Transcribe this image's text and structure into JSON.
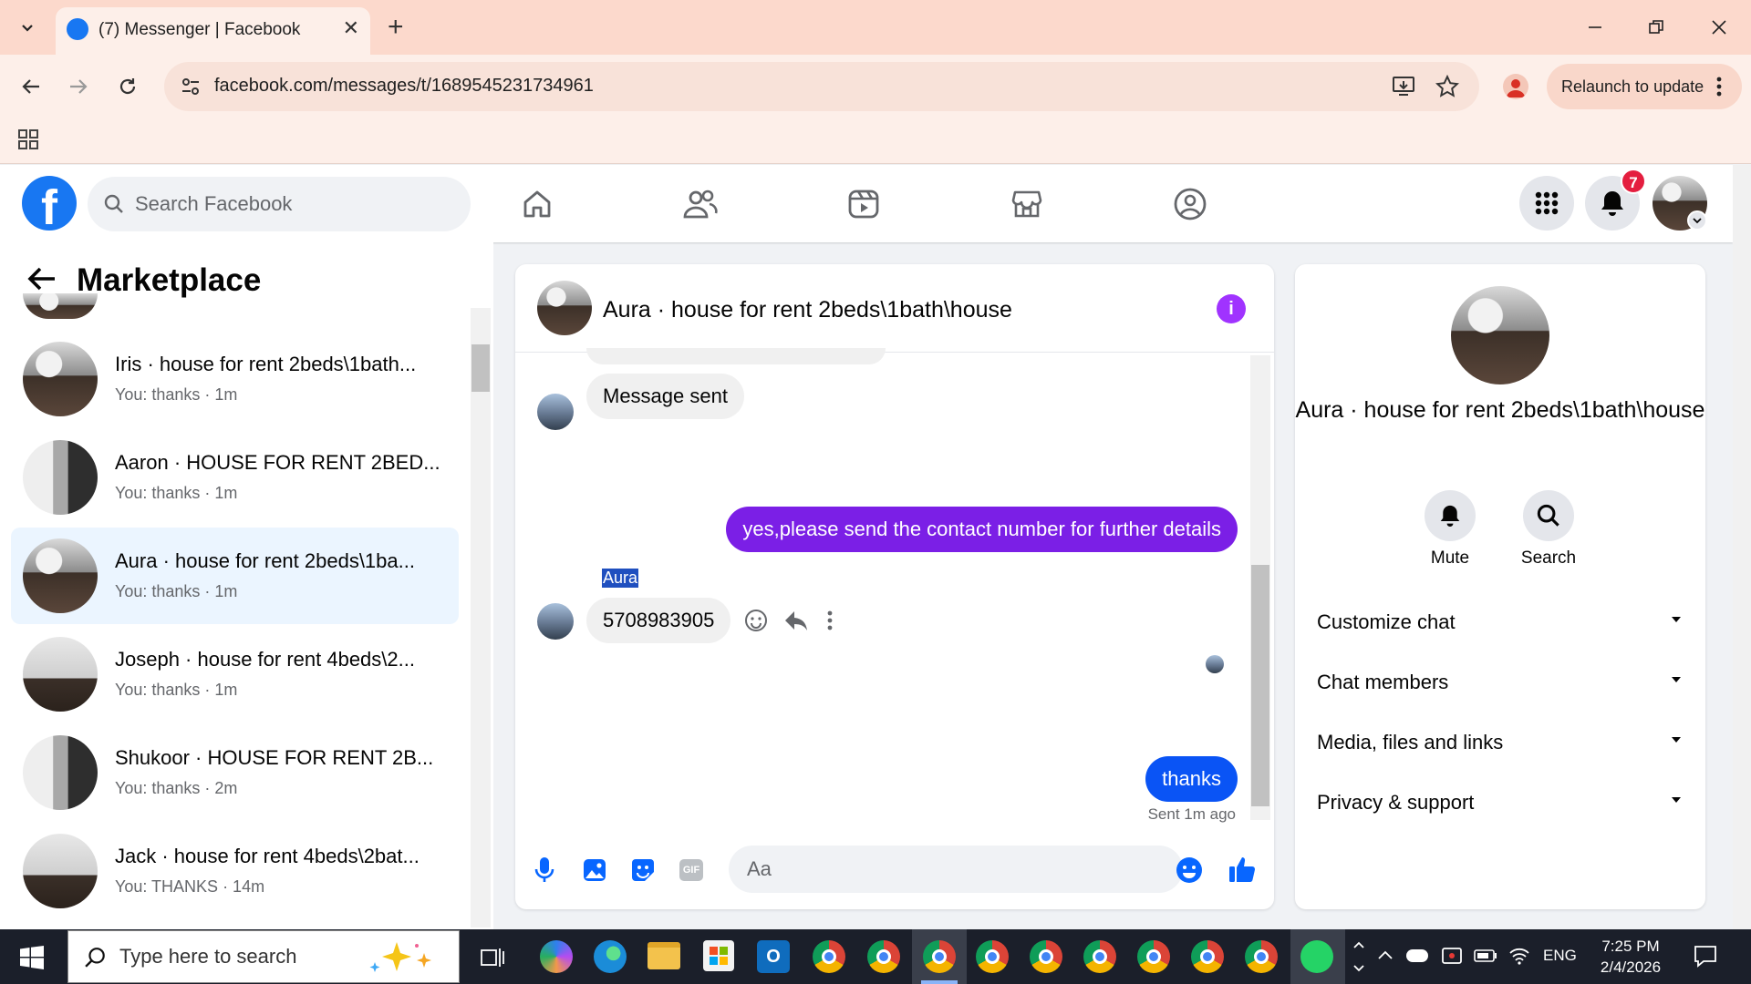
{
  "browser": {
    "tab_title": "(7) Messenger | Facebook",
    "url": "facebook.com/messages/t/1689545231734961",
    "relaunch_label": "Relaunch to update"
  },
  "fb_header": {
    "logo": "f",
    "search_placeholder": "Search Facebook",
    "notification_count": "7"
  },
  "sidebar": {
    "title": "Marketplace",
    "conversations": [
      {
        "name": "Iris · house for rent 2beds\\1bath...",
        "preview": "You: thanks · 1m"
      },
      {
        "name": "Aaron · HOUSE FOR RENT 2BED...",
        "preview": "You: thanks · 1m"
      },
      {
        "name": "Aura · house for rent 2beds\\1ba...",
        "preview": "You: thanks · 1m"
      },
      {
        "name": "Joseph · house for rent 4beds\\2...",
        "preview": "You: thanks · 1m"
      },
      {
        "name": "Shukoor · HOUSE FOR RENT 2B...",
        "preview": "You: thanks · 2m"
      },
      {
        "name": "Jack · house for rent 4beds\\2bat...",
        "preview": "You: THANKS · 14m"
      }
    ]
  },
  "chat": {
    "title": "Aura · house for rent 2beds\\1bath\\house",
    "messages": {
      "m1": "Message sent",
      "m2": "yes,please send the contact number for further details",
      "sender": "Aura",
      "m3": "5708983905",
      "m4": "thanks",
      "status": "Sent 1m ago"
    },
    "input_placeholder": "Aa"
  },
  "info": {
    "name": "Aura · house for rent 2beds\\1bath\\house",
    "mute_label": "Mute",
    "search_label": "Search",
    "sections": [
      "Customize chat",
      "Chat members",
      "Media, files and links",
      "Privacy & support"
    ]
  },
  "taskbar": {
    "search_placeholder": "Type here to search",
    "language": "ENG",
    "time": "7:25 PM",
    "date": "2/4/2026"
  },
  "colors": {
    "fb_blue": "#1877f2",
    "outgoing_purple": "#7b1fe6",
    "outgoing_blue": "#0a54f5",
    "info_purple": "#a033ff"
  }
}
